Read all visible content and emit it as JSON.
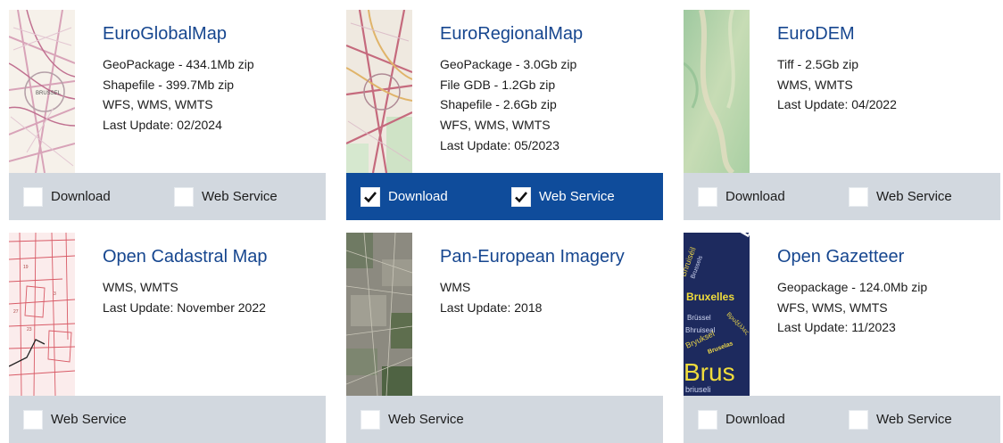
{
  "cards": [
    {
      "title": "EuroGlobalMap",
      "lines": [
        "GeoPackage - 434.1Mb zip",
        "Shapefile - 399.7Mb zip",
        "WFS, WMS, WMTS",
        "Last Update: 02/2024"
      ],
      "options": [
        {
          "label": "Download",
          "checked": false
        },
        {
          "label": "Web Service",
          "checked": false
        }
      ],
      "selected": false
    },
    {
      "title": "EuroRegionalMap",
      "lines": [
        "GeoPackage - 3.0Gb zip",
        "File GDB - 1.2Gb zip",
        "Shapefile - 2.6Gb zip",
        "WFS, WMS, WMTS",
        "Last Update: 05/2023"
      ],
      "options": [
        {
          "label": "Download",
          "checked": true
        },
        {
          "label": "Web Service",
          "checked": true
        }
      ],
      "selected": true
    },
    {
      "title": "EuroDEM",
      "lines": [
        "Tiff - 2.5Gb zip",
        "WMS, WMTS",
        "Last Update: 04/2022"
      ],
      "options": [
        {
          "label": "Download",
          "checked": false
        },
        {
          "label": "Web Service",
          "checked": false
        }
      ],
      "selected": false
    },
    {
      "title": "Open Cadastral Map",
      "lines": [
        "WMS, WMTS",
        "Last Update: November 2022"
      ],
      "options": [
        {
          "label": "Web Service",
          "checked": false
        }
      ],
      "selected": false
    },
    {
      "title": "Pan-European Imagery",
      "lines": [
        "WMS",
        "Last Update: 2018"
      ],
      "options": [
        {
          "label": "Web Service",
          "checked": false
        }
      ],
      "selected": false
    },
    {
      "title": "Open Gazetteer",
      "lines": [
        "Geopackage - 124.0Mb zip",
        "WFS, WMS, WMTS",
        "Last Update: 11/2023"
      ],
      "options": [
        {
          "label": "Download",
          "checked": false
        },
        {
          "label": "Web Service",
          "checked": false
        }
      ],
      "selected": false
    }
  ],
  "thumbnail_text": {
    "map_label": "BRUSSEL",
    "gazetteer_words": [
      "Брисел",
      "Bhruiséil",
      "Brussels",
      "Bruxelles",
      "Brüssel",
      "Bhruiseal",
      "Βρυξέλλες",
      "Bruselas",
      "Bryuksel",
      "Brus",
      "briuseli"
    ]
  },
  "colors": {
    "accent": "#16468f",
    "selected_bar": "#0f4c9b",
    "bar": "#d2d8df"
  }
}
